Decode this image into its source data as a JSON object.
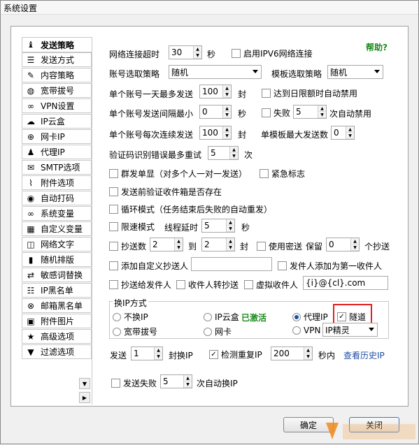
{
  "window": {
    "title": "系统设置"
  },
  "sidebar": {
    "items": [
      {
        "label": "发送策略",
        "icon": "figure-icon",
        "glyph": "♝"
      },
      {
        "label": "发送方式",
        "icon": "list-icon",
        "glyph": "☰"
      },
      {
        "label": "内容策略",
        "icon": "pencil-icon",
        "glyph": "✎"
      },
      {
        "label": "宽带拔号",
        "icon": "globe-icon",
        "glyph": "◍"
      },
      {
        "label": "VPN设置",
        "icon": "link-icon",
        "glyph": "∞"
      },
      {
        "label": "IP云盒",
        "icon": "cloud-icon",
        "glyph": "☁"
      },
      {
        "label": "网卡IP",
        "icon": "globe-icon",
        "glyph": "⊕"
      },
      {
        "label": "代理IP",
        "icon": "user-icon",
        "glyph": "♟"
      },
      {
        "label": "SMTP选项",
        "icon": "mail-icon",
        "glyph": "✉"
      },
      {
        "label": "附件选项",
        "icon": "paperclip-icon",
        "glyph": "⌇"
      },
      {
        "label": "自动打码",
        "icon": "eye-icon",
        "glyph": "◉"
      },
      {
        "label": "系统变量",
        "icon": "infinity-icon",
        "glyph": "∞"
      },
      {
        "label": "自定义变量",
        "icon": "grid-icon",
        "glyph": "▦"
      },
      {
        "label": "网络文字",
        "icon": "book-icon",
        "glyph": "◫"
      },
      {
        "label": "随机排版",
        "icon": "phone-icon",
        "glyph": "▮"
      },
      {
        "label": "敏感词替换",
        "icon": "shuffle-icon",
        "glyph": "⇄"
      },
      {
        "label": "IP黑名单",
        "icon": "ordered-list-icon",
        "glyph": "☷"
      },
      {
        "label": "邮箱黑名单",
        "icon": "block-icon",
        "glyph": "⊗"
      },
      {
        "label": "附件图片",
        "icon": "picture-icon",
        "glyph": "▣"
      },
      {
        "label": "高级选项",
        "icon": "star-icon",
        "glyph": "★"
      },
      {
        "label": "过滤选项",
        "icon": "filter-icon",
        "glyph": "▼"
      }
    ]
  },
  "main": {
    "help": "帮助?",
    "timeout_label": "网络连接超时",
    "timeout_value": "30",
    "sec": "秒",
    "ipv6_label": "启用IPV6网络连接",
    "account_strategy_label": "账号选取策略",
    "account_strategy_value": "随机",
    "template_strategy_label": "模板选取策略",
    "template_strategy_value": "随机",
    "max_per_day_label": "单个账号一天最多发送",
    "max_per_day_value": "100",
    "unit_feng": "封",
    "daily_limit_label": "达到日限额时自动禁用",
    "interval_label": "单个账号发送间隔最小",
    "interval_value": "0",
    "fail_label": "失败",
    "fail_value": "5",
    "fail_suffix": "次自动禁用",
    "consecutive_label": "单个账号每次连续发送",
    "consecutive_value": "100",
    "template_max_label": "单模板最大发送数",
    "template_max_value": "0",
    "captcha_label": "验证码识别错误最多重试",
    "captcha_value": "5",
    "unit_ci": "次",
    "group_single_label": "群发单显（对多个人一对一发送）",
    "urgent_label": "紧急标志",
    "verify_inbox_label": "发送前验证收件箱是否存在",
    "loop_label": "循环模式（任务结束后失败的自动重发）",
    "speed_label": "限速模式",
    "thread_delay_label": "线程延时",
    "thread_delay_value": "5",
    "cc_count_label": "抄送数",
    "cc_from": "2",
    "cc_to_label": "到",
    "cc_to": "2",
    "bcc_label": "使用密送",
    "keep_label": "保留",
    "keep_value": "0",
    "keep_suffix": "个抄送",
    "custom_cc_label": "添加自定义抄送人",
    "custom_cc_value": "",
    "sender_first_label": "发件人添加为第一收件人",
    "cc_sender_label": "抄送给发件人",
    "recipient_forward_label": "收件人转抄送",
    "virtual_recipient_label": "虚拟收件人",
    "virtual_recipient_value": "{i}@{cl}.com",
    "ip_mode_title": "换IP方式",
    "opt_none": "不换IP",
    "opt_ipbox": "IP云盒",
    "activated": "已激活",
    "opt_proxy": "代理IP",
    "opt_tunnel": "隧道",
    "opt_broadband": "宽带拔号",
    "opt_nic": "网卡",
    "opt_vpn": "VPN",
    "vpn_select": "IP精灵",
    "send_label": "发送",
    "send_value": "1",
    "switch_ip_label": "封换IP",
    "check_dup_label": "检测重复IP",
    "check_dup_value": "200",
    "seconds_within": "秒内",
    "history_link": "查看历史IP",
    "send_fail_label": "发送失败",
    "send_fail_value": "5",
    "send_fail_suffix": "次自动换IP"
  },
  "footer": {
    "ok": "确定",
    "close": "关闭"
  }
}
